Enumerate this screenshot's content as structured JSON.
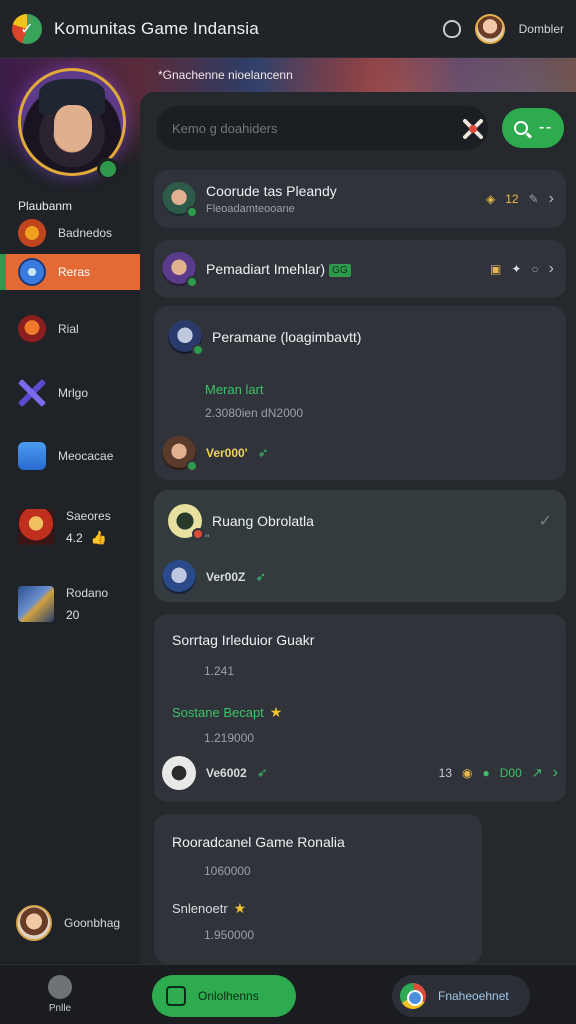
{
  "app": {
    "title": "Komunitas Game Indansia",
    "user_name": "Dombler"
  },
  "banner": {
    "caption": "*Gnachenne nioelancenn"
  },
  "sidebar": {
    "heading": "Plaubanm",
    "items": [
      {
        "label": "Badnedos",
        "icon": "trophy-icon"
      },
      {
        "label": "Reras",
        "icon": "globe-icon",
        "active": true
      },
      {
        "label": "Rial",
        "icon": "helmet-avatar-icon"
      },
      {
        "label": "Mrlgo",
        "icon": "crossed-swords-icon"
      },
      {
        "label": "Meocacae",
        "icon": "inbox-icon"
      },
      {
        "label": "Saeores",
        "value": "4.2",
        "icon": "warrior-avatar-icon"
      },
      {
        "label": "Rodano",
        "value": "20",
        "icon": "sword-avatar-icon"
      }
    ],
    "footer_user": "Goonbhag"
  },
  "search": {
    "placeholder": "Kemo g doahiders"
  },
  "cards": {
    "c1": {
      "title": "Coorude tas Pleandy",
      "subtitle": "Fleoadamteooane",
      "count": "12"
    },
    "c2": {
      "title": "Pemadiart Imehlar)",
      "tag": "GG"
    },
    "c3": {
      "title": "Peramane (loagimbavtt)",
      "highlight": "Meran lart",
      "meta": "2.3080ien dN2000",
      "user": "Ver000'"
    },
    "c4": {
      "title": "Ruang Obrolatla",
      "note": "\"",
      "user": "Ver00Z"
    },
    "c5": {
      "title": "Sorrtag Irleduior Guakr",
      "meta": "1.241",
      "highlight": "Sostane Becapt",
      "meta2": "1.219000",
      "user": "Ve6002",
      "stats_left": "13",
      "stats_right": "D00"
    },
    "c6": {
      "title": "Rooradcanel Game Ronalia",
      "meta": "1060000",
      "highlight": "Snlenoetr",
      "meta2": "1.950000"
    }
  },
  "bottom": {
    "home_label": "Pnlle",
    "left_pill": "Onlolhenns",
    "right_pill": "Fnaheoehnet"
  },
  "colors": {
    "accent_green": "#2eaa4f",
    "active_orange": "#e36a35",
    "gold": "#e0a93a"
  }
}
